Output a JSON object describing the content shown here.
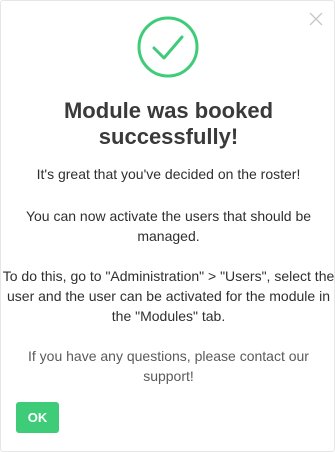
{
  "dialog": {
    "icons": {
      "close": "close-icon",
      "success": "checkmark-circle-icon"
    },
    "title": "Module was booked successfully!",
    "paragraphs": [
      "It's great that you've decided on the roster!",
      "You can now activate the users that should be managed.",
      "To do this, go to \"Administration\" > \"Users\", select the user and the user can be activated for the module in the \"Modules\" tab.",
      "If you have any questions, please contact our support!"
    ],
    "ok_label": "OK"
  },
  "colors": {
    "accent": "#3ecc79",
    "title_text": "#3a3a3a",
    "body_text": "#2f2f2f",
    "muted_text": "#5a5a5a",
    "close_icon": "#c8c8c8"
  }
}
